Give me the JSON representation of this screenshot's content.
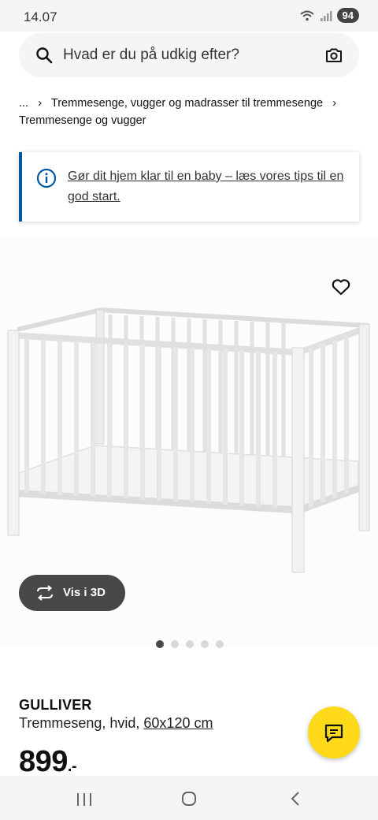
{
  "status": {
    "time": "14.07",
    "battery": "94"
  },
  "search": {
    "placeholder": "Hvad er du på udkig efter?"
  },
  "breadcrumb": {
    "ellipsis": "...",
    "level1": "Tremmesenge, vugger og madrasser til tremmesenge",
    "level2": "Tremmesenge og vugger"
  },
  "banner": {
    "text": "Gør dit hjem klar til en baby – læs vores tips til en god start."
  },
  "gallery": {
    "view3d_label": "Vis i 3D",
    "dot_count": 5,
    "active_index": 0
  },
  "product": {
    "name": "GULLIVER",
    "description": "Tremmeseng, hvid,",
    "size": "60x120 cm",
    "price": "899",
    "price_suffix": ".-"
  },
  "colors": {
    "accent_blue": "#0058a3",
    "chat_yellow": "#ffda1a",
    "dark_button": "#484848"
  },
  "icons": [
    "search-icon",
    "camera-icon",
    "info-icon",
    "heart-icon",
    "rotate-icon",
    "chat-icon"
  ]
}
